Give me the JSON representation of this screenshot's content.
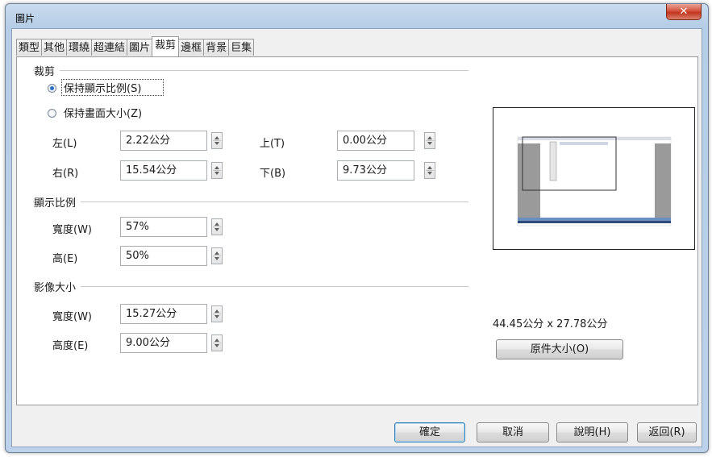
{
  "window": {
    "title": "圖片",
    "close_glyph": "✕"
  },
  "tabs": [
    {
      "label": "類型",
      "active": false
    },
    {
      "label": "其他",
      "active": false
    },
    {
      "label": "環繞",
      "active": false
    },
    {
      "label": "超連結",
      "active": false
    },
    {
      "label": "圖片",
      "active": false
    },
    {
      "label": "裁剪",
      "active": true
    },
    {
      "label": "邊框",
      "active": false
    },
    {
      "label": "背景",
      "active": false
    },
    {
      "label": "巨集",
      "active": false
    }
  ],
  "crop": {
    "group_label": "裁剪",
    "keep_scale": {
      "label": "保持顯示比例(S)",
      "selected": true
    },
    "keep_size": {
      "label": "保持畫面大小(Z)",
      "selected": false
    },
    "left": {
      "label": "左(L)",
      "value": "2.22公分"
    },
    "right": {
      "label": "右(R)",
      "value": "15.54公分"
    },
    "top": {
      "label": "上(T)",
      "value": "0.00公分"
    },
    "bottom": {
      "label": "下(B)",
      "value": "9.73公分"
    }
  },
  "scale": {
    "group_label": "顯示比例",
    "width": {
      "label": "寬度(W)",
      "value": "57%"
    },
    "height": {
      "label": "高(E)",
      "value": "50%"
    }
  },
  "image_size": {
    "group_label": "影像大小",
    "width": {
      "label": "寬度(W)",
      "value": "15.27公分"
    },
    "height": {
      "label": "高度(E)",
      "value": "9.00公分"
    }
  },
  "original": {
    "size_text": "44.45公分 x 27.78公分",
    "button_label": "原件大小(O)"
  },
  "buttons": {
    "ok": "確定",
    "cancel": "取消",
    "help": "說明(H)",
    "reset": "返回(R)"
  },
  "colors": {
    "accent": "#2a6fc2",
    "close": "#c2341d"
  }
}
